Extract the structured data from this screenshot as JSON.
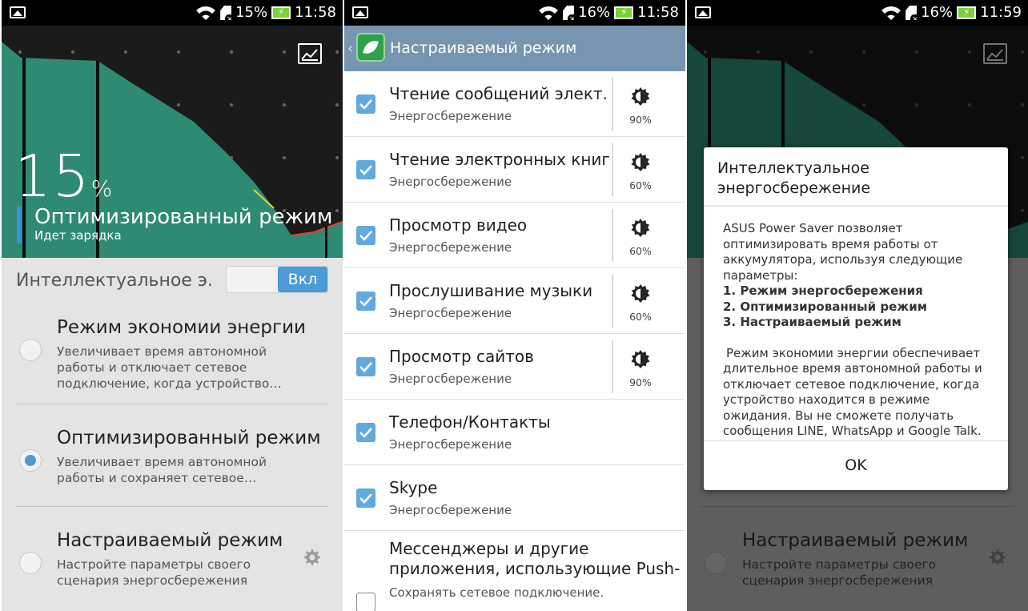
{
  "screens": [
    {
      "status": {
        "battery_pct": "15%",
        "time": "11:58"
      },
      "battery": {
        "level": "15",
        "unit": "%",
        "mode_title": "Оптимизированный режим",
        "mode_sub": "Идет зарядка"
      },
      "smart_saving": {
        "label": "Интеллектуальное э.",
        "toggle": "Вкл"
      },
      "modes": [
        {
          "title": "Режим экономии энергии",
          "desc": "Увеличивает время автономной работы и отключает сетевое подключение, когда устройство…",
          "selected": false
        },
        {
          "title": "Оптимизированный режим",
          "desc": "Увеличивает время автономной работы и сохраняет сетевое…",
          "selected": true
        },
        {
          "title": "Настраиваемый режим",
          "desc": "Настройте параметры своего сценария энергосбережения",
          "selected": false
        }
      ]
    },
    {
      "status": {
        "battery_pct": "16%",
        "time": "11:58"
      },
      "appbar": {
        "title": "Настраиваемый режим"
      },
      "items": [
        {
          "title": "Чтение сообщений элект.",
          "sub": "Энергосбережение",
          "brightness": "90%",
          "checked": true
        },
        {
          "title": "Чтение электронных книг",
          "sub": "Энергосбережение",
          "brightness": "60%",
          "checked": true
        },
        {
          "title": "Просмотр видео",
          "sub": "Энергосбережение",
          "brightness": "60%",
          "checked": true
        },
        {
          "title": "Прослушивание музыки",
          "sub": "Энергосбережение",
          "brightness": "60%",
          "checked": true
        },
        {
          "title": "Просмотр сайтов",
          "sub": "Энергосбережение",
          "brightness": "90%",
          "checked": true
        },
        {
          "title": "Телефон/Контакты",
          "sub": "Энергосбережение",
          "checked": true
        },
        {
          "title": "Skype",
          "sub": "Энергосбережение",
          "checked": true
        }
      ],
      "last_item": {
        "title_line1": "Мессенджеры и другие",
        "title_line2": "приложения, использующие Push-",
        "sub": "Сохранять сетевое подключение.",
        "checked": false
      }
    },
    {
      "status": {
        "battery_pct": "16%",
        "time": "11:59"
      },
      "dialog": {
        "title": "Интеллектуальное энергосбережение",
        "intro": "ASUS Power Saver позволяет оптимизировать время работы от аккумулятора, используя следующие параметры:",
        "option1": "1. Режим энергосбережения",
        "option2": "2. Оптимизированный режим",
        "option3": "3. Настраиваемый режим",
        "detail": "Режим экономии энергии обеспечивает длительное время автономной работы и отключает сетевое подключение, когда устройство находится в режиме ожидания. Вы не сможете получать сообщения LINE, WhatsApp и Google Talk.",
        "ok": "OK"
      },
      "bg_mode": {
        "title": "Настраиваемый режим",
        "desc": "Настройте параметры своего сценария энергосбережения"
      }
    }
  ],
  "colors": {
    "accent": "#4a9bd6",
    "graph_fill": "#2e8a72",
    "appbar": "#7695b1",
    "battery_charging": "#7bd03b"
  },
  "icons": [
    "picture-icon",
    "gallery-icon",
    "wifi-icon",
    "sdcard-icon",
    "battery-charging-icon",
    "gear-icon",
    "brightness-icon",
    "check-icon",
    "leaf-app-icon",
    "back-chevron-icon"
  ]
}
